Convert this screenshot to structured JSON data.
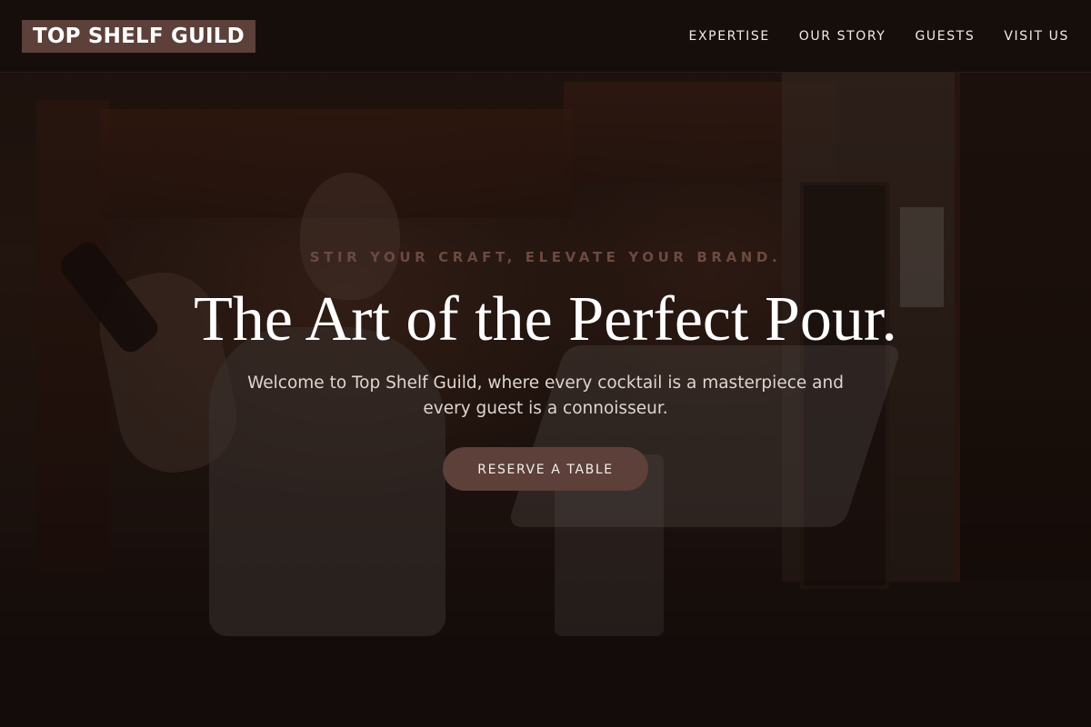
{
  "header": {
    "logo": "TOP SHELF GUILD",
    "nav": [
      {
        "label": "EXPERTISE"
      },
      {
        "label": "OUR STORY"
      },
      {
        "label": "GUESTS"
      },
      {
        "label": "VISIT US"
      }
    ]
  },
  "hero": {
    "eyebrow": "STIR YOUR CRAFT, ELEVATE YOUR BRAND.",
    "headline": "The Art of the Perfect Pour.",
    "subtext": "Welcome to Top Shelf Guild, where every cocktail is a masterpiece and every guest is a connoisseur.",
    "cta_label": "RESERVE A TABLE"
  },
  "colors": {
    "accent": "#5c4039",
    "background": "#140e0c",
    "eyebrow": "#6b4a40",
    "headline": "#ffffff"
  }
}
